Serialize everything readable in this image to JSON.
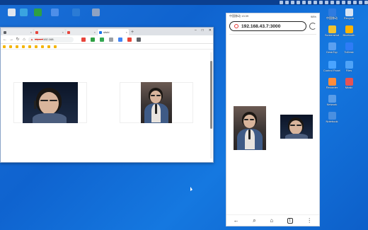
{
  "desktop": {
    "left_icons": [
      {
        "label": "",
        "color": "#e0e6ee"
      },
      {
        "label": "",
        "color": "#3aa4e0"
      },
      {
        "label": "",
        "color": "#2ea043"
      },
      {
        "label": "",
        "color": "#4f8fe8"
      },
      {
        "label": "",
        "color": "#2b7bd5"
      },
      {
        "label": "",
        "color": "#8ea2c2"
      }
    ],
    "right_icons_col1": [
      {
        "label": "中国移动",
        "color": "#2f7be0"
      },
      {
        "label": "Screenshot",
        "color": "#f0c230"
      },
      {
        "label": "DeskTop",
        "color": "#5aa0f0"
      },
      {
        "label": "Control Panel",
        "color": "#4aa4ff"
      },
      {
        "label": "Recorder",
        "color": "#ff8c3a"
      },
      {
        "label": "Network",
        "color": "#5a9de8"
      },
      {
        "label": "Notebook",
        "color": "#4a8fe0"
      }
    ],
    "right_icons_col2": [
      {
        "label": "Recycle",
        "color": "#d7e3f2"
      },
      {
        "label": "Bluetooth",
        "color": "#ffb300"
      },
      {
        "label": "ToDesk",
        "color": "#2e7cf6"
      },
      {
        "label": "Files",
        "color": "#4fa3f7"
      },
      {
        "label": "Music",
        "color": "#e55353"
      }
    ]
  },
  "browser": {
    "tabs": [
      {
        "title": "",
        "color": "#5f6368"
      },
      {
        "title": "",
        "color": "#e8453c"
      },
      {
        "title": "",
        "color": "#e8453c"
      },
      {
        "title": "sfsfd",
        "color": "#1a73e8",
        "active": true
      }
    ],
    "url_prefix": "https://",
    "url_rest": "192.168.",
    "toolbar_icons": [
      "#e8453c",
      "#2ea043",
      "#34a853",
      "#9aa0a6",
      "#4285f4",
      "#ea4335",
      "#5f6368"
    ],
    "bookmarks": [
      "",
      "",
      "",
      "",
      "",
      "",
      "",
      "",
      ""
    ]
  },
  "phone": {
    "status_left": "中国移动 13:39",
    "status_right": "98%",
    "url": "192.168.43.7:3000",
    "nav_tabs_count": "1"
  }
}
